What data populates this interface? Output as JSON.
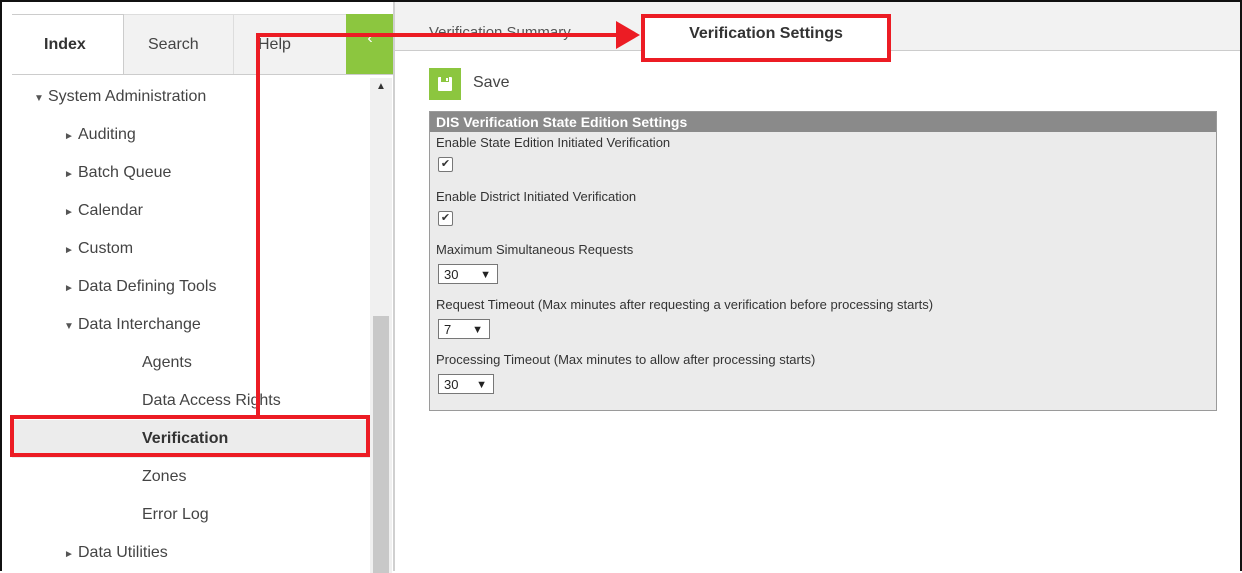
{
  "left_panel": {
    "tabs": [
      {
        "label": "Index"
      },
      {
        "label": "Search"
      },
      {
        "label": "Help"
      }
    ],
    "collapse_icon": "chevron-left-icon",
    "tree": [
      {
        "label": "System Administration",
        "expanded": true,
        "level": 0
      },
      {
        "label": "Auditing",
        "expanded": false,
        "level": 1
      },
      {
        "label": "Batch Queue",
        "expanded": false,
        "level": 1
      },
      {
        "label": "Calendar",
        "expanded": false,
        "level": 1
      },
      {
        "label": "Custom",
        "expanded": false,
        "level": 1
      },
      {
        "label": "Data Defining Tools",
        "expanded": false,
        "level": 1
      },
      {
        "label": "Data Interchange",
        "expanded": true,
        "level": 1
      },
      {
        "label": "Agents",
        "level": 2
      },
      {
        "label": "Data Access Rights",
        "level": 2
      },
      {
        "label": "Verification",
        "level": 2,
        "selected": true
      },
      {
        "label": "Zones",
        "level": 2
      },
      {
        "label": "Error Log",
        "level": 2
      },
      {
        "label": "Data Utilities",
        "expanded": false,
        "level": 1
      }
    ]
  },
  "right_panel": {
    "tabs": [
      {
        "label": "Verification Summary"
      },
      {
        "label": "Verification Settings",
        "active": true
      }
    ],
    "toolbar": {
      "save_label": "Save",
      "save_icon": "save-icon"
    },
    "settings": {
      "header": "DIS Verification State Edition Settings",
      "enable_state_label": "Enable State Edition Initiated Verification",
      "enable_state_checked": true,
      "enable_district_label": "Enable District Initiated Verification",
      "enable_district_checked": true,
      "max_requests_label": "Maximum Simultaneous Requests",
      "max_requests_value": "30",
      "request_timeout_label": "Request Timeout (Max minutes after requesting a verification before processing starts)",
      "request_timeout_value": "7",
      "processing_timeout_label": "Processing Timeout (Max minutes to allow after processing starts)",
      "processing_timeout_value": "30"
    }
  },
  "colors": {
    "accent_green": "#8cc63f",
    "annotation_red": "#ec1c24",
    "section_header": "#8a8a8a"
  }
}
